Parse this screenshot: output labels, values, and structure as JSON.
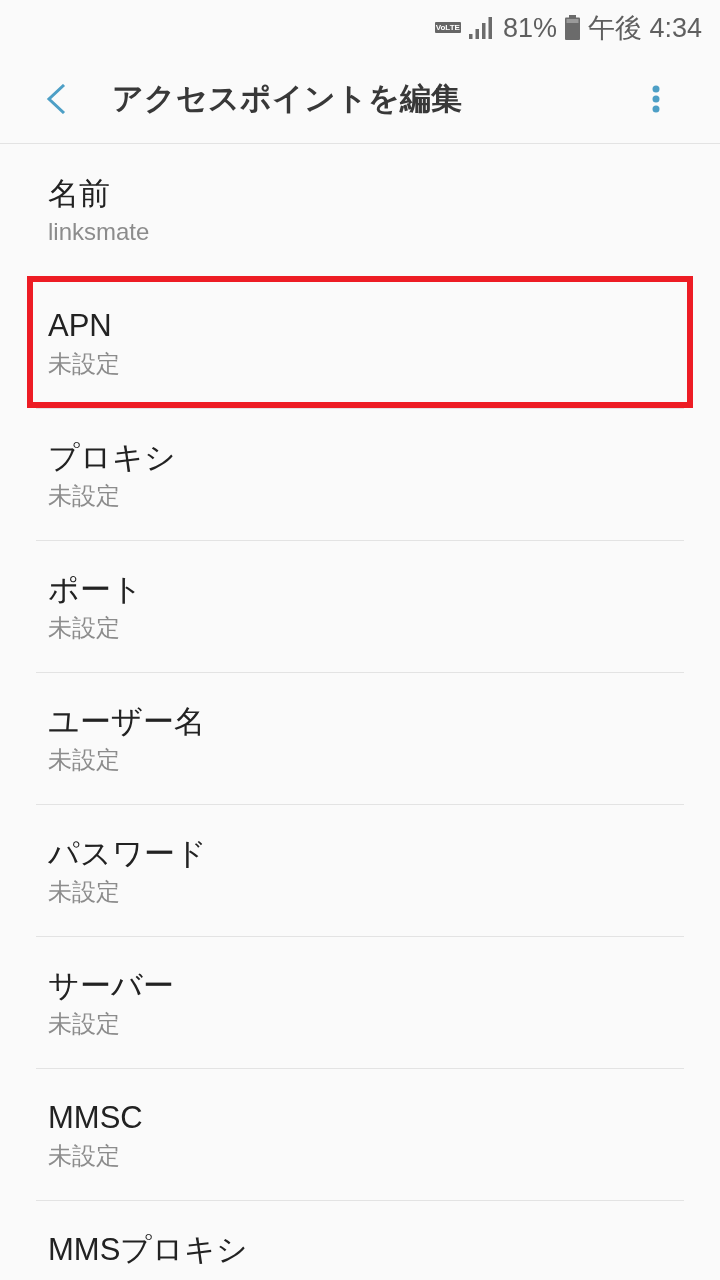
{
  "status_bar": {
    "network_badge": "VoLTE",
    "battery": "81%",
    "time": "午後 4:34"
  },
  "toolbar": {
    "title": "アクセスポイントを編集"
  },
  "fields": [
    {
      "label": "名前",
      "value": "linksmate",
      "highlighted": false
    },
    {
      "label": "APN",
      "value": "未設定",
      "highlighted": true
    },
    {
      "label": "プロキシ",
      "value": "未設定",
      "highlighted": false
    },
    {
      "label": "ポート",
      "value": "未設定",
      "highlighted": false
    },
    {
      "label": "ユーザー名",
      "value": "未設定",
      "highlighted": false
    },
    {
      "label": "パスワード",
      "value": "未設定",
      "highlighted": false
    },
    {
      "label": "サーバー",
      "value": "未設定",
      "highlighted": false
    },
    {
      "label": "MMSC",
      "value": "未設定",
      "highlighted": false
    },
    {
      "label": "MMSプロキシ",
      "highlighted": false
    }
  ]
}
